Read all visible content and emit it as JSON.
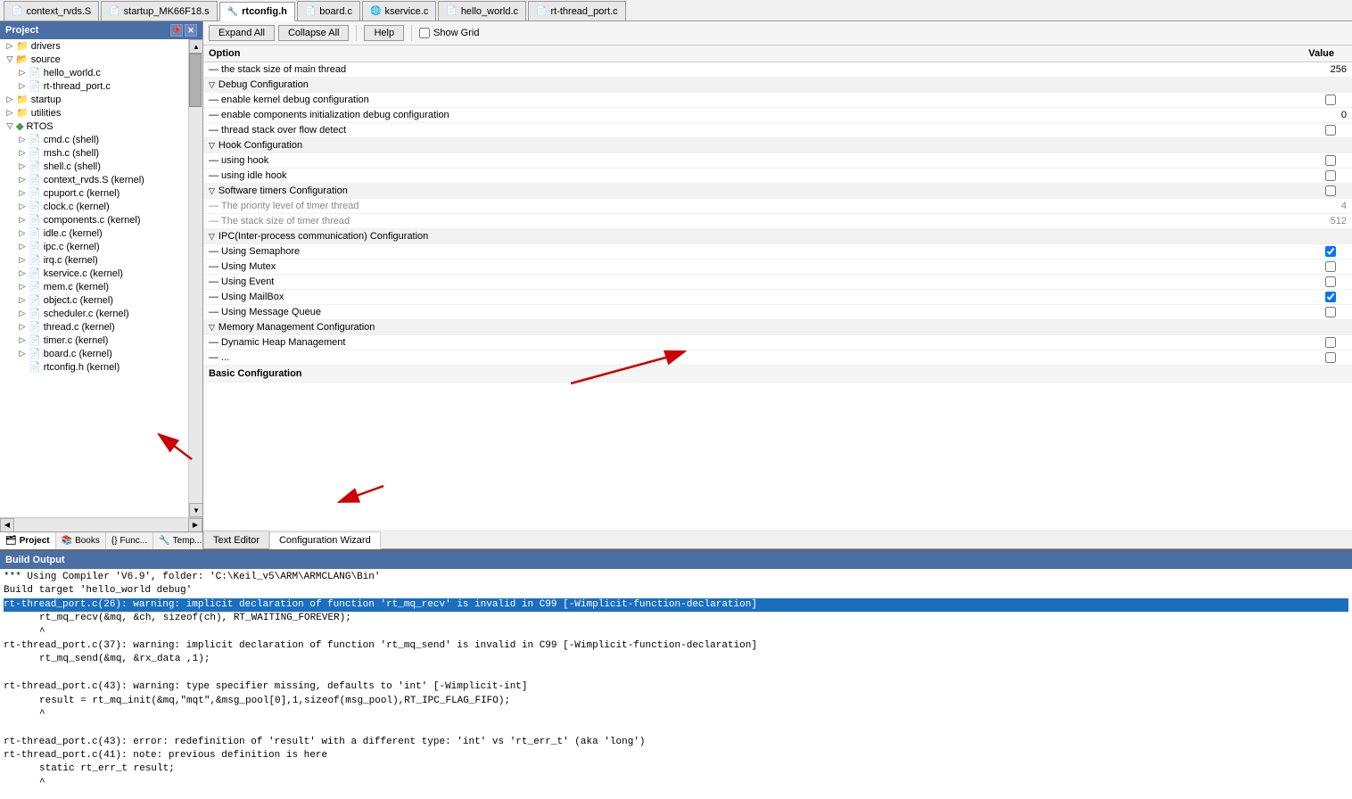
{
  "tabs": [
    {
      "id": "context_rvds",
      "label": "context_rvds.S",
      "icon": "📄",
      "active": false
    },
    {
      "id": "startup_mk66",
      "label": "startup_MK66F18.s",
      "icon": "📄",
      "active": false
    },
    {
      "id": "rtconfig",
      "label": "rtconfig.h",
      "icon": "📄",
      "active": true
    },
    {
      "id": "board",
      "label": "board.c",
      "icon": "📄",
      "active": false
    },
    {
      "id": "kservice",
      "label": "kservice.c",
      "icon": "📄",
      "active": false
    },
    {
      "id": "hello_world",
      "label": "hello_world.c",
      "icon": "📄",
      "active": false
    },
    {
      "id": "rt_thread_port",
      "label": "rt-thread_port.c",
      "icon": "📄",
      "active": false
    }
  ],
  "toolbar": {
    "expand_all": "Expand All",
    "collapse_all": "Collapse All",
    "help": "Help",
    "show_grid": "Show Grid"
  },
  "sidebar": {
    "title": "Project",
    "tree": [
      {
        "level": 1,
        "type": "folder",
        "label": "drivers",
        "expanded": true
      },
      {
        "level": 1,
        "type": "folder",
        "label": "source",
        "expanded": true
      },
      {
        "level": 2,
        "type": "file",
        "label": "hello_world.c"
      },
      {
        "level": 2,
        "type": "file",
        "label": "rt-thread_port.c"
      },
      {
        "level": 1,
        "type": "folder",
        "label": "startup",
        "expanded": false
      },
      {
        "level": 1,
        "type": "folder",
        "label": "utilities",
        "expanded": false
      },
      {
        "level": 1,
        "type": "rtos",
        "label": "RTOS",
        "expanded": true
      },
      {
        "level": 2,
        "type": "file",
        "label": "cmd.c (shell)"
      },
      {
        "level": 2,
        "type": "file",
        "label": "msh.c (shell)"
      },
      {
        "level": 2,
        "type": "file",
        "label": "shell.c (shell)"
      },
      {
        "level": 2,
        "type": "file",
        "label": "context_rvds.S (kernel)"
      },
      {
        "level": 2,
        "type": "file",
        "label": "cpuport.c (kernel)"
      },
      {
        "level": 2,
        "type": "file",
        "label": "clock.c (kernel)"
      },
      {
        "level": 2,
        "type": "file",
        "label": "components.c (kernel)"
      },
      {
        "level": 2,
        "type": "file",
        "label": "idle.c (kernel)"
      },
      {
        "level": 2,
        "type": "file",
        "label": "ipc.c (kernel)"
      },
      {
        "level": 2,
        "type": "file",
        "label": "irq.c (kernel)"
      },
      {
        "level": 2,
        "type": "file",
        "label": "kservice.c (kernel)"
      },
      {
        "level": 2,
        "type": "file",
        "label": "mem.c (kernel)"
      },
      {
        "level": 2,
        "type": "file",
        "label": "object.c (kernel)"
      },
      {
        "level": 2,
        "type": "file",
        "label": "scheduler.c (kernel)"
      },
      {
        "level": 2,
        "type": "file",
        "label": "thread.c (kernel)"
      },
      {
        "level": 2,
        "type": "file",
        "label": "timer.c (kernel)"
      },
      {
        "level": 2,
        "type": "file",
        "label": "board.c (kernel)"
      },
      {
        "level": 2,
        "type": "file",
        "label": "rtconfig.h (kernel)"
      }
    ],
    "bottom_tabs": [
      {
        "label": "Project",
        "icon": "🗂",
        "active": true
      },
      {
        "label": "Books",
        "icon": "📚",
        "active": false
      },
      {
        "label": "Func...",
        "icon": "{}",
        "active": false
      },
      {
        "label": "Temp...",
        "icon": "🔧",
        "active": false
      }
    ]
  },
  "config": {
    "columns": [
      "Option",
      "Value"
    ],
    "rows": [
      {
        "type": "item",
        "indent": 2,
        "label": "the stack size of main thread",
        "value": "256",
        "value_type": "text"
      },
      {
        "type": "section",
        "label": "Debug Configuration"
      },
      {
        "type": "item",
        "indent": 3,
        "label": "enable kernel debug configuration",
        "value": "",
        "value_type": "checkbox",
        "checked": false
      },
      {
        "type": "item",
        "indent": 3,
        "label": "enable components initialization debug configuration",
        "value": "0",
        "value_type": "text"
      },
      {
        "type": "item",
        "indent": 3,
        "label": "thread stack over flow detect",
        "value": "",
        "value_type": "checkbox",
        "checked": false
      },
      {
        "type": "section",
        "label": "Hook Configuration"
      },
      {
        "type": "item",
        "indent": 3,
        "label": "using hook",
        "value": "",
        "value_type": "checkbox",
        "checked": false
      },
      {
        "type": "item",
        "indent": 3,
        "label": "using idle hook",
        "value": "",
        "value_type": "checkbox",
        "checked": false
      },
      {
        "type": "section",
        "label": "Software timers Configuration",
        "checkbox": true,
        "checked": false
      },
      {
        "type": "item",
        "indent": 3,
        "label": "The priority level of timer thread",
        "value": "4",
        "value_type": "text",
        "disabled": true
      },
      {
        "type": "item",
        "indent": 3,
        "label": "The stack size of timer thread",
        "value": "512",
        "value_type": "text",
        "disabled": true
      },
      {
        "type": "section",
        "label": "IPC(Inter-process communication) Configuration"
      },
      {
        "type": "item",
        "indent": 3,
        "label": "Using Semaphore",
        "value": "",
        "value_type": "checkbox",
        "checked": true
      },
      {
        "type": "item",
        "indent": 3,
        "label": "Using Mutex",
        "value": "",
        "value_type": "checkbox",
        "checked": false
      },
      {
        "type": "item",
        "indent": 3,
        "label": "Using Event",
        "value": "",
        "value_type": "checkbox",
        "checked": false
      },
      {
        "type": "item",
        "indent": 3,
        "label": "Using MailBox",
        "value": "",
        "value_type": "checkbox",
        "checked": true
      },
      {
        "type": "item",
        "indent": 3,
        "label": "Using Message Queue",
        "value": "",
        "value_type": "checkbox",
        "checked": false
      },
      {
        "type": "section",
        "label": "Memory Management Configuration"
      },
      {
        "type": "item",
        "indent": 3,
        "label": "Dynamic Heap Management",
        "value": "",
        "value_type": "checkbox",
        "checked": false
      },
      {
        "type": "item",
        "indent": 3,
        "label": "...",
        "value": "",
        "value_type": "checkbox",
        "checked": false
      }
    ],
    "basic_config_label": "Basic Configuration"
  },
  "editor_tabs": [
    {
      "label": "Text Editor",
      "active": false
    },
    {
      "label": "Configuration Wizard",
      "active": true
    }
  ],
  "build_output": {
    "title": "Build Output",
    "lines": [
      {
        "text": "*** Using Compiler 'V6.9', folder: 'C:\\Keil_v5\\ARM\\ARMCLANG\\Bin'",
        "type": "normal"
      },
      {
        "text": "Build target 'hello_world debug'",
        "type": "normal"
      },
      {
        "text": "rt-thread_port.c(26): warning: implicit declaration of function 'rt_mq_recv' is invalid in C99 [-Wimplicit-function-declaration]",
        "type": "highlight"
      },
      {
        "text": "        rt_mq_recv(&mq, &ch, sizeof(ch), RT_WAITING_FOREVER);",
        "type": "normal",
        "indent": true
      },
      {
        "text": "        ^",
        "type": "normal",
        "indent": true
      },
      {
        "text": "rt-thread_port.c(37): warning: implicit declaration of function 'rt_mq_send' is invalid in C99 [-Wimplicit-function-declaration]",
        "type": "normal"
      },
      {
        "text": "        rt_mq_send(&mq, &rx_data ,1);",
        "type": "normal",
        "indent": true
      },
      {
        "text": "",
        "type": "normal"
      },
      {
        "text": "rt-thread_port.c(43): warning: type specifier missing, defaults to 'int' [-Wimplicit-int]",
        "type": "normal"
      },
      {
        "text": "    result = rt_mq_init(&mq,\"mqt\",&msg_pool[0],1,sizeof(msg_pool),RT_IPC_FLAG_FIFO);",
        "type": "normal",
        "indent": true
      },
      {
        "text": "    ^",
        "type": "normal",
        "indent": true
      },
      {
        "text": "",
        "type": "normal"
      },
      {
        "text": "rt-thread_port.c(43): error: redefinition of 'result' with a different type: 'int' vs 'rt_err_t' (aka 'long')",
        "type": "normal"
      },
      {
        "text": "rt-thread_port.c(41): note: previous definition is here",
        "type": "normal"
      },
      {
        "text": "    static rt_err_t result;",
        "type": "normal",
        "indent": true
      },
      {
        "text": "    ^",
        "type": "normal",
        "indent": true
      }
    ]
  }
}
